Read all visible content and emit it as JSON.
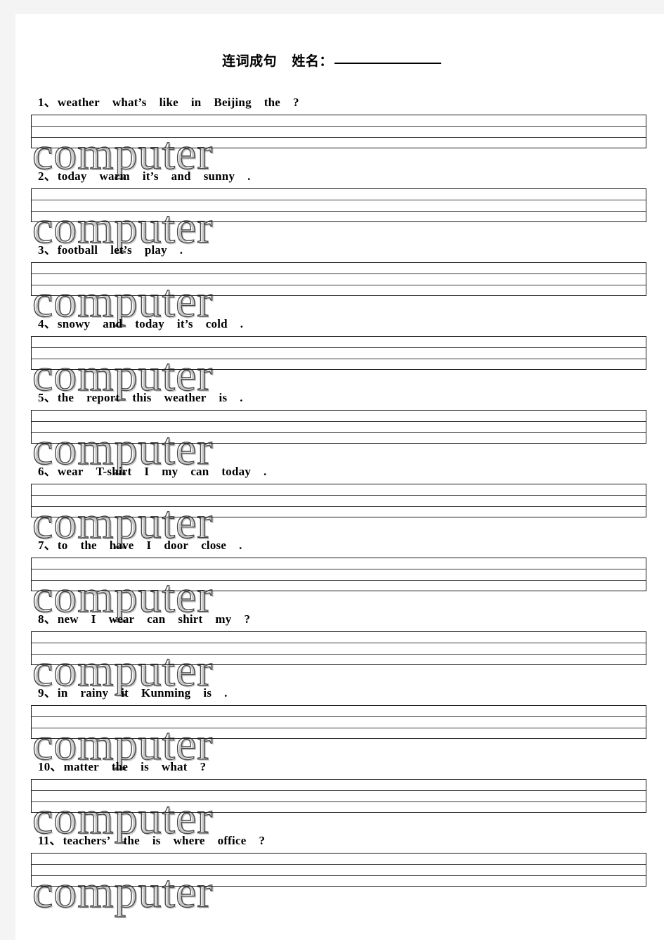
{
  "header": {
    "title": "连词成句",
    "name_label": "姓名：",
    "name_value": ""
  },
  "watermark": {
    "text": "computer"
  },
  "questions": [
    {
      "number": "1、",
      "text": "weather    what’s   like     in     Beijing   the ?",
      "words": [
        "weather",
        "what’s",
        "like",
        "in",
        "Beijing",
        "the",
        "?"
      ]
    },
    {
      "number": "2、",
      "text": "today   warm   it’s   and    sunny .",
      "words": [
        "today",
        "warm",
        "it’s",
        "and",
        "sunny",
        "."
      ]
    },
    {
      "number": "3、",
      "text": "football   let’s   play .",
      "words": [
        "football",
        "let’s",
        "play",
        "."
      ]
    },
    {
      "number": "4、",
      "text": "snowy   and   today   it’s   cold .",
      "words": [
        "snowy",
        "and",
        "today",
        "it’s",
        "cold",
        "."
      ]
    },
    {
      "number": "5、",
      "text": "the   report   this   weather   is .",
      "words": [
        "the",
        "report",
        "this",
        "weather",
        "is",
        "."
      ]
    },
    {
      "number": "6、",
      "text": "wear   T-shirt   I   my   can   today .",
      "words": [
        "wear",
        "T-shirt",
        "I",
        "my",
        "can",
        "today",
        "."
      ]
    },
    {
      "number": "7、",
      "text": "to   the   have   I   door   close .",
      "words": [
        "to",
        "the",
        "have",
        "I",
        "door",
        "close",
        "."
      ]
    },
    {
      "number": "8、",
      "text": "new   I   wear   can   shirt   my ?",
      "words": [
        "new",
        "I",
        "wear",
        "can",
        "shirt",
        "my",
        "?"
      ]
    },
    {
      "number": "9、",
      "text": "in   rainy   it   Kunming   is .",
      "words": [
        "in",
        "rainy",
        "it",
        "Kunming",
        "is",
        "."
      ]
    },
    {
      "number": "10、",
      "text": "matter   the   is   what   ?",
      "words": [
        "matter",
        "the",
        "is",
        "what",
        "?"
      ]
    },
    {
      "number": "11、",
      "text": "teachers’   the   is   where office   ?",
      "words": [
        "teachers’",
        "the",
        "is",
        "where",
        "office",
        "?"
      ]
    }
  ]
}
